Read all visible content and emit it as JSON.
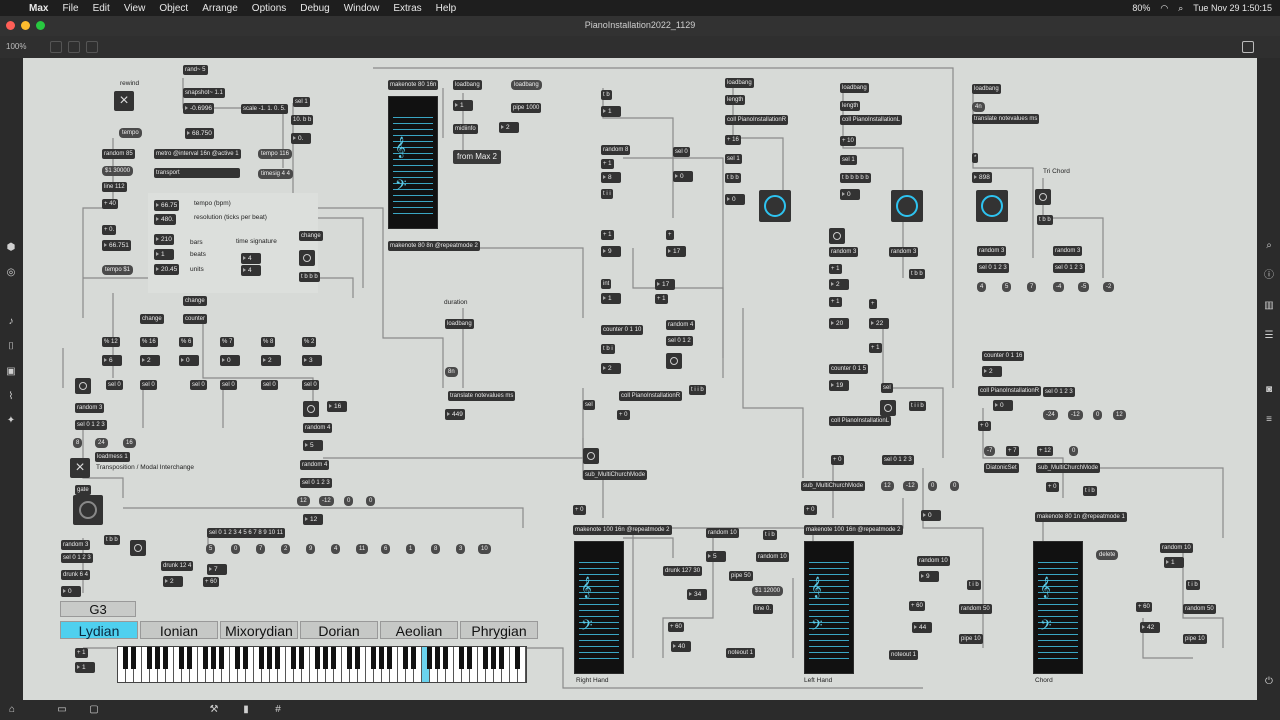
{
  "menubar": {
    "items": [
      "Max",
      "File",
      "Edit",
      "View",
      "Object",
      "Arrange",
      "Options",
      "Debug",
      "Window",
      "Extras",
      "Help"
    ],
    "battery": "80%",
    "datetime": "Tue Nov 29  1:50:15"
  },
  "window": {
    "title": "PianoInstallation2022_1129",
    "zoom": "100%"
  },
  "colors": {
    "accent": "#2ec3f0",
    "canvas": "#d7dad7",
    "object": "#333333"
  },
  "objects": {
    "rewind": "rewind",
    "rand5": "rand~ 5",
    "snapshot": "snapshot~ 1.1",
    "neg6996": "-0.6996",
    "scale": "scale -1. 1. 0. 5.",
    "sel1": "sel 1",
    "t0bb": "10. b b",
    "zero_pt": "0.",
    "tempo_msg": "tempo",
    "tempo_num": "68.750",
    "random85": "random 85",
    "metro": "metro @interval 16n @active 1",
    "tempo116": "tempo 116",
    "s30000": "$1 30000",
    "line112": "line 112",
    "plus40": "+ 40",
    "transport": "transport",
    "timesig": "timesig 4 4",
    "plus0": "+ 0.",
    "v66751": "66.751",
    "tempo_s1": "tempo $1",
    "bpm_val": "66.75",
    "bpm_label": "tempo (bpm)",
    "res_val": "480.",
    "res_label": "resolution (ticks per beat)",
    "bars_val": "210",
    "bars_label": "bars",
    "beats_val": "1",
    "beats_label": "beats",
    "units_val": "20.45",
    "units_label": "units",
    "timesig_label": "time signature",
    "ts_num": "4",
    "ts_den": "4",
    "change1": "change",
    "tbbb1": "t b b b",
    "change2": "change",
    "change3": "change",
    "counter": "counter",
    "mod12": "% 12",
    "mod16": "% 16",
    "mod6": "% 6",
    "mod7": "% 7",
    "mod8": "% 8",
    "mod2": "% 2",
    "n6": "6",
    "n2a": "2",
    "n0a": "0",
    "n0b": "0",
    "n2b": "2",
    "n3": "3",
    "sel0": "sel 0",
    "n16": "16",
    "random3a": "random 3",
    "sel0123a": "sel 0 1 2 3",
    "m8": "8",
    "m24": "24",
    "m16": "16",
    "random4a": "random 4",
    "n5": "5",
    "random4b": "random 4",
    "sel0123b": "sel 0 1 2 3",
    "m12": "12",
    "mm12": "-12",
    "m0a": "0",
    "m0b": "0",
    "n12": "12",
    "loadmess": "loadmess 1",
    "transposition": "Transposition / Modal Interchange",
    "gate": "gate",
    "tbb_a": "t b b",
    "random3b": "random 3",
    "sel0123c": "sel 0 1 2 3",
    "drunk64": "drunk 6 4",
    "n0c": "0",
    "drunk124": "drunk 12 4",
    "plus60a": "+ 60",
    "n7": "7",
    "n2c": "2",
    "selbig": "sel 0 1 2 3 4 5 6 7 8 9 10 11",
    "row_vals": [
      "5",
      "0",
      "7",
      "2",
      "9",
      "4",
      "11",
      "6",
      "1",
      "8",
      "3",
      "10"
    ],
    "g3": "G3",
    "modes": [
      "Lydian",
      "Ionian",
      "Mixorydian",
      "Dorian",
      "Aeolian",
      "Phrygian"
    ],
    "plus1": "+ 1",
    "n1a": "1",
    "makenote1": "makenote 80 16n",
    "makenote1b": "makenote 80 8n @repeatmode 2",
    "loadbang1": "loadbang",
    "loadbang2": "loadbang",
    "n1b": "1",
    "pipe1000": "pipe 1000",
    "midiinfo": "midiinfo",
    "n2d": "2",
    "from_max": "from Max 2",
    "duration": "duration",
    "loadbang3": "loadbang",
    "eighth": "8n",
    "translate1": "translate notevalues ms",
    "n449": "449",
    "tb1": "t b",
    "n1c": "1",
    "random8": "random 8",
    "plus1b": "+ 1",
    "n8": "8",
    "tii": "t i i",
    "sel0b": "sel 0",
    "n0d": "0",
    "plus1c": "+ 1",
    "n9": "9",
    "plus_c": "+",
    "n17a": "17",
    "int": "int",
    "n1d": "1",
    "n17b": "17",
    "plus1d": "+ 1",
    "counter0110": "counter 0 1 10",
    "random4c": "random 4",
    "tbi": "t b i",
    "sel012a": "sel 0 1 2",
    "n2e": "2",
    "coll_r1": "coll PianoInstallationR",
    "plus0b": "+ 0",
    "tiib": "t i i b",
    "sel": "sel",
    "sub_mcm1": "sub_MultiChurchMode",
    "plus0c": "+ 0",
    "makenote2": "makenote 100 16n @repeatmode 2",
    "random10a": "random 10",
    "tib_a": "t i b",
    "n5b": "5",
    "random10b": "random 10",
    "drunk127": "drunk 127 30",
    "pipe50a": "pipe 50",
    "n34": "34",
    "s12000": "$1 12000",
    "line0": "line 0.",
    "plus60b": "+ 60",
    "n40": "40",
    "noteout1": "noteout 1",
    "right_hand": "Right Hand",
    "loadbang4": "loadbang",
    "length1": "length",
    "coll_r2": "coll PianoInstallationR",
    "plus16": "+ 16",
    "sel1b": "sel 1",
    "tbb_b": "t b b",
    "n0e": "0",
    "loadbang5": "loadbang",
    "length2": "length",
    "coll_l1": "coll PianoInstallationL",
    "plus10": "+ 10",
    "sel1c": "sel 1",
    "tbbbbb": "t b b b b b",
    "n0f": "0",
    "random3c": "random 3",
    "random3d": "random 3",
    "plus1e": "+ 1",
    "n2f": "2",
    "tbb_c": "t b b",
    "plus1f": "+ 1",
    "n20": "20",
    "plus_d": "+",
    "n22": "22",
    "plus1g": "+ 1",
    "counter015": "counter 0 1 5",
    "n19": "19",
    "sel_b": "sel",
    "tiib2": "t i i b",
    "coll_l2": "coll PianoInstallationL",
    "plus0d": "+ 0",
    "sel0123d": "sel 0 1 2 3",
    "sub_mcm2": "sub_MultiChurchMode",
    "m12b": "12",
    "mm12b": "-12",
    "m0c": "0",
    "m0d": "0",
    "n0g": "0",
    "makenote3": "makenote 100 16n @repeatmode 2",
    "left_hand": "Left Hand",
    "random10c": "random 10",
    "n9b": "9",
    "tib_b": "t i b",
    "plus60c": "+ 60",
    "random50a": "random 50",
    "n44": "44",
    "pipe10a": "pipe 10",
    "noteout1b": "noteout 1",
    "loadbang6": "loadbang",
    "fourn": "4n",
    "translate2": "translate notevalues ms",
    "n898": "898",
    "tri_chord": "Tri Chord",
    "tbb_d": "t b b",
    "random3e": "random 3",
    "random3f": "random 3",
    "sel0123e": "sel 0 1 2 3",
    "sel0123f": "sel 0 1 2 3",
    "c4": "4",
    "c5": "5",
    "c7": "7",
    "cm4": "-4",
    "cm5": "-5",
    "cm2": "-2",
    "counter0116": "counter 0 1 16",
    "n2g": "2",
    "coll_r3": "coll PianoInstallationR",
    "sel0123g": "sel 0 1 2 3",
    "n0h": "0",
    "mm24": "-24",
    "mm12c": "-12",
    "m0e": "0",
    "m12c": "12",
    "plus0e": "+ 0",
    "n7b": "-7",
    "plus7": "+ 7",
    "plus12": "+ 12",
    "n0i": "0",
    "diatonic": "DiatonicSet",
    "sub_mcm3": "sub_MultiChurchMode",
    "plus0f": "+ 0",
    "tib_c": "t i b",
    "makenote4": "makenote 80 1n @repeatmode 1",
    "chord_label": "Chord",
    "random10d": "random 10",
    "n1e": "1",
    "tib_d": "t i b",
    "plus60d": "+ 60",
    "random50b": "random 50",
    "n42": "42",
    "pipe10b": "pipe 10",
    "noteout1c": "noteout 1",
    "del": "delete"
  }
}
